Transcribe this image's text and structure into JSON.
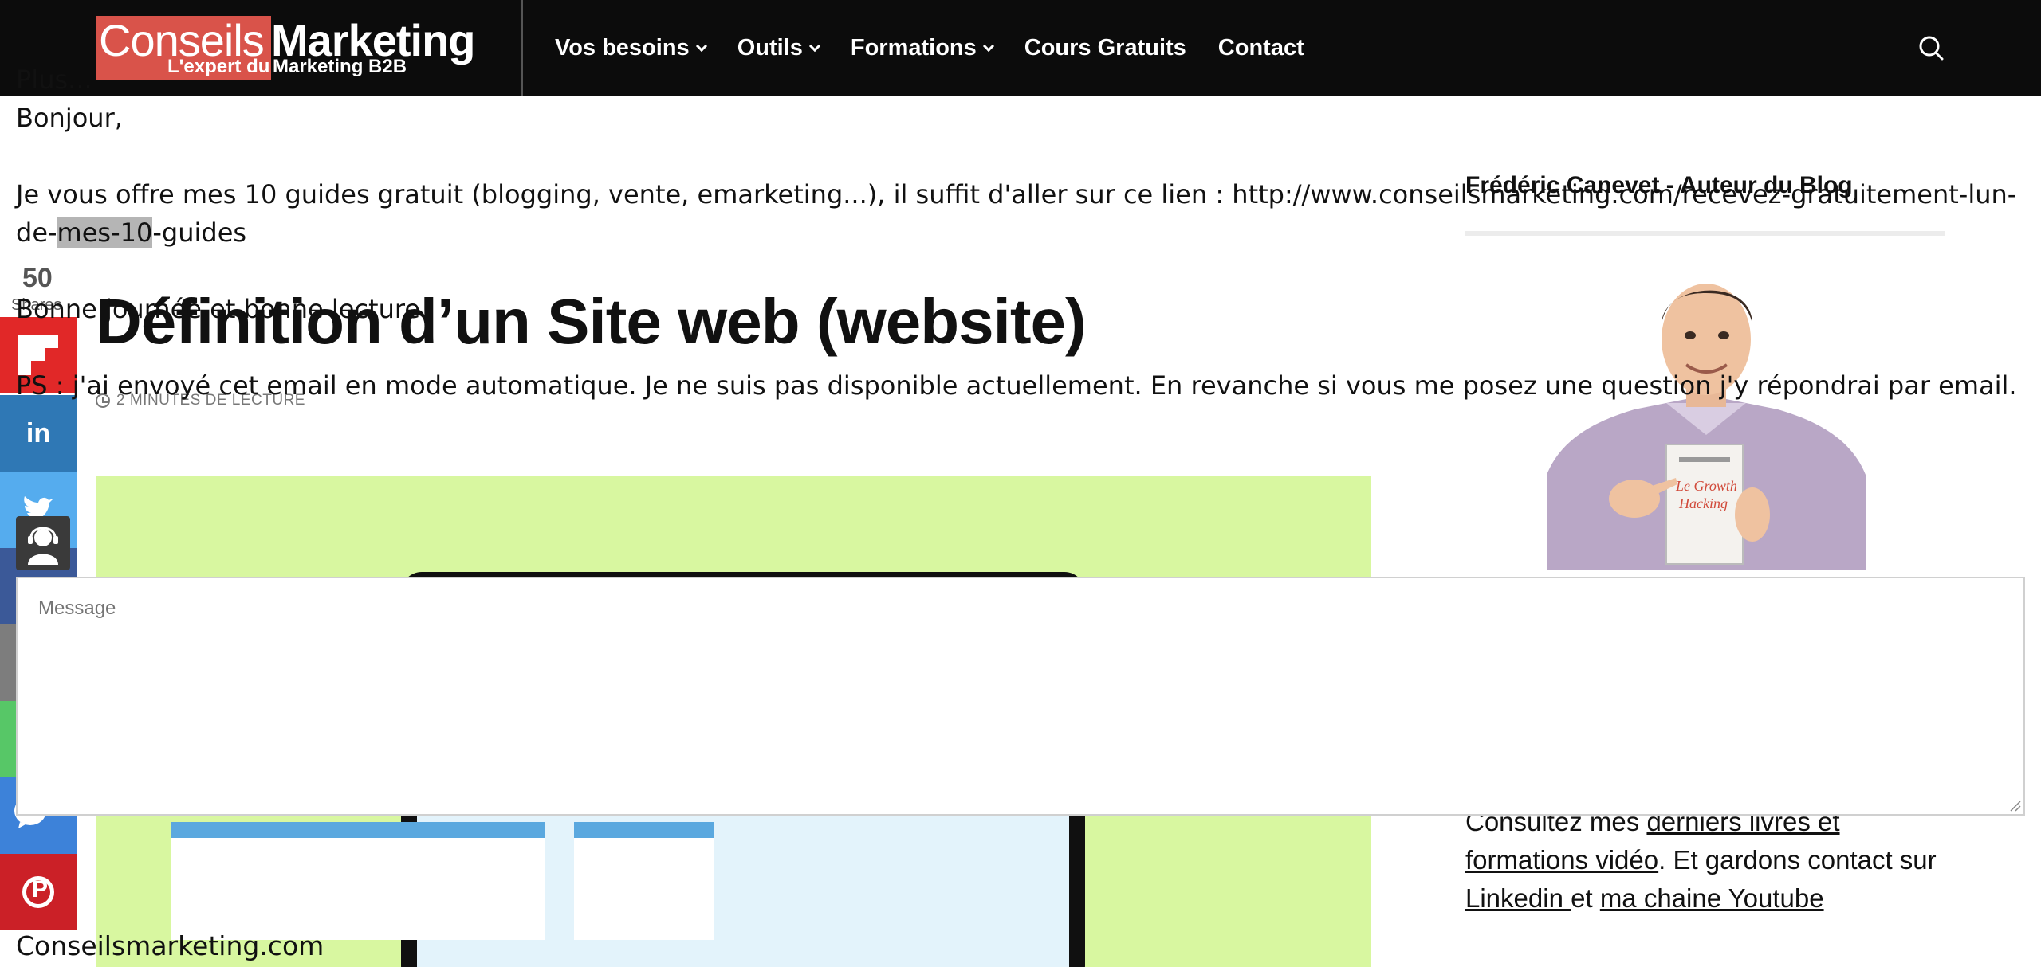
{
  "header": {
    "logo": {
      "word1": "Conseils",
      "word2": "Marketing",
      "tagline1": "L'expert du",
      "tagline2": "Marketing B2B"
    },
    "nav": [
      {
        "label": "Vos besoins",
        "has_dropdown": true
      },
      {
        "label": "Outils",
        "has_dropdown": true
      },
      {
        "label": "Formations",
        "has_dropdown": true
      },
      {
        "label": "Cours Gratuits",
        "has_dropdown": false
      },
      {
        "label": "Contact",
        "has_dropdown": false
      }
    ],
    "search_icon": "search-icon"
  },
  "share": {
    "count": "50",
    "label": "Shares",
    "networks": [
      "flipboard",
      "linkedin",
      "twitter",
      "facebook",
      "email",
      "whatsapp",
      "messenger",
      "pinterest"
    ]
  },
  "article": {
    "title": "Définition d’un Site web (website)",
    "reading_time": "2 MINUTES DE LECTURE"
  },
  "sidebar": {
    "title": "Frédéric Canevet - Auteur du Blog",
    "bio_prefix": "Consultez mes ",
    "link_books": "derniers livres et formations vidéo",
    "bio_middle": ". Et gardons contact sur ",
    "link_linkedin": "Linkedin ",
    "bio_and": "et ",
    "link_youtube": "ma chaine Youtube",
    "book_title": "Le Growth Hacking"
  },
  "auto_reply": {
    "plus": "Plus...",
    "greeting": "Bonjour,",
    "line1": "Je vous offre mes 10 guides gratuit (blogging, vente, emarketing...), il suffit d'aller sur ce lien : http://www.conseilsmarketing.com/recevez-gratuitement-lun-de-",
    "line1_highlight": "mes-10",
    "line1_end": "-guides",
    "line2": "Bonne journée et bonne lecture",
    "line3": "PS : j'ai envoyé cet email en mode automatique. Je ne suis pas disponible actuellement. En revanche si vous me posez une question j'y répondrai par email.",
    "signature": "Conseilsmarketing.com"
  },
  "message": {
    "placeholder": "Message"
  },
  "colors": {
    "header_bg": "#0c0c0c",
    "logo_red": "#d9534a",
    "hero_bg": "#d8f7a0"
  }
}
